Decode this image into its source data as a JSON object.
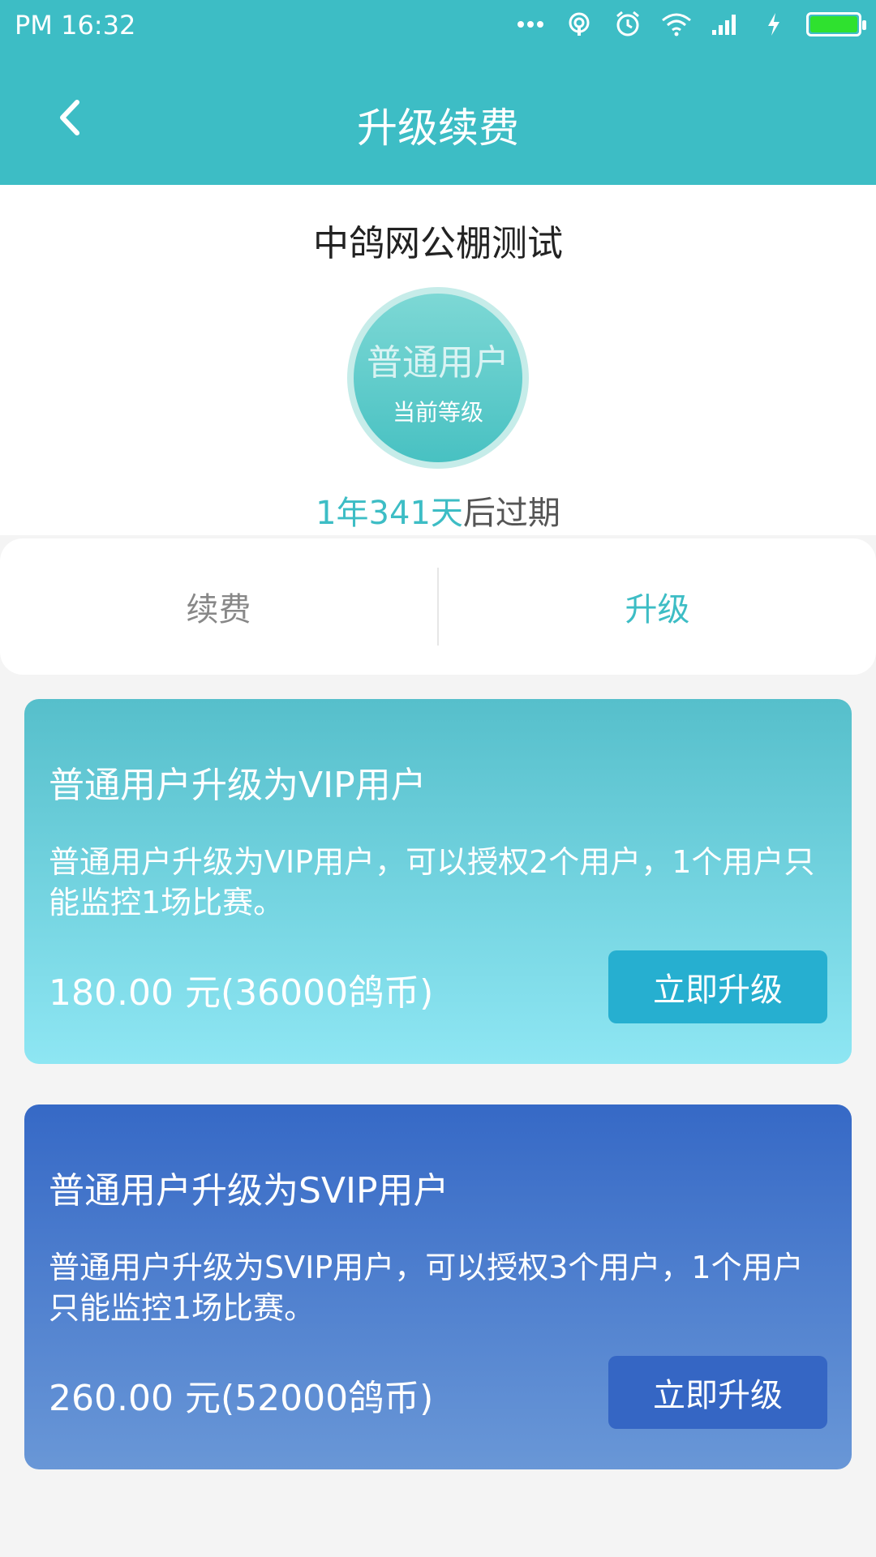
{
  "status_bar": {
    "time": "PM  16:32"
  },
  "nav": {
    "title": "升级续费"
  },
  "profile": {
    "name": "中鸽网公棚测试",
    "level_name": "普通用户",
    "level_caption": "当前等级",
    "expiry_highlight": "1年341天",
    "expiry_suffix": "后过期"
  },
  "tabs": [
    {
      "label": "续费",
      "active": false
    },
    {
      "label": "升级",
      "active": true
    }
  ],
  "plans": [
    {
      "title": "普通用户升级为VIP用户",
      "description": "普通用户升级为VIP用户，可以授权2个用户，1个用户只能监控1场比赛。",
      "price": "180.00 元(36000鸽币)",
      "button": "立即升级"
    },
    {
      "title": "普通用户升级为SVIP用户",
      "description": "普通用户升级为SVIP用户，可以授权3个用户，1个用户只能监控1场比赛。",
      "price": "260.00 元(52000鸽币)",
      "button": "立即升级"
    }
  ],
  "colors": {
    "accent": "#3dbdc5",
    "vip_button": "#26afd0",
    "svip_button": "#3566c4",
    "battery": "#2fe12f"
  }
}
